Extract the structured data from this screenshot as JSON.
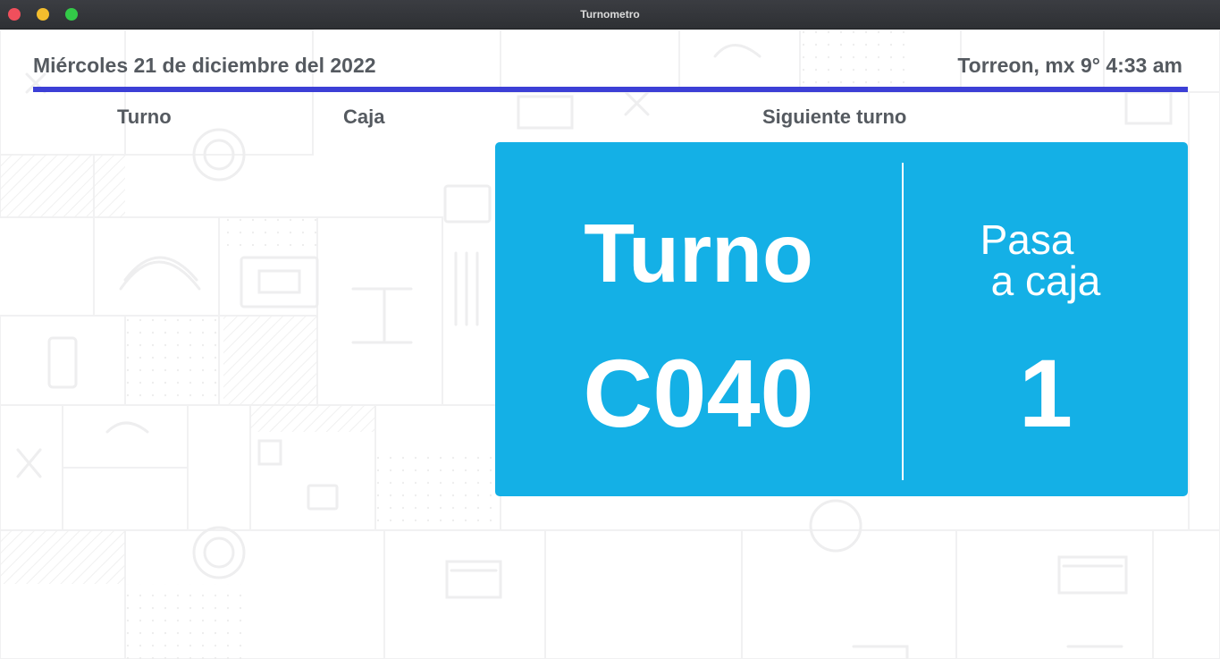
{
  "window": {
    "title": "Turnometro"
  },
  "header": {
    "date": "Miércoles 21 de diciembre del 2022",
    "weather": "Torreon, mx 9° 4:33 am"
  },
  "columns": {
    "turno": "Turno",
    "caja": "Caja",
    "next": "Siguiente turno"
  },
  "next_turn": {
    "label": "Turno",
    "code": "C040",
    "pasa_line1": "Pasa",
    "pasa_line2": "a caja",
    "caja_number": "1"
  },
  "colors": {
    "accent_rule": "#3c3fd6",
    "card_background": "#14b0e6",
    "text": "#555a60"
  }
}
